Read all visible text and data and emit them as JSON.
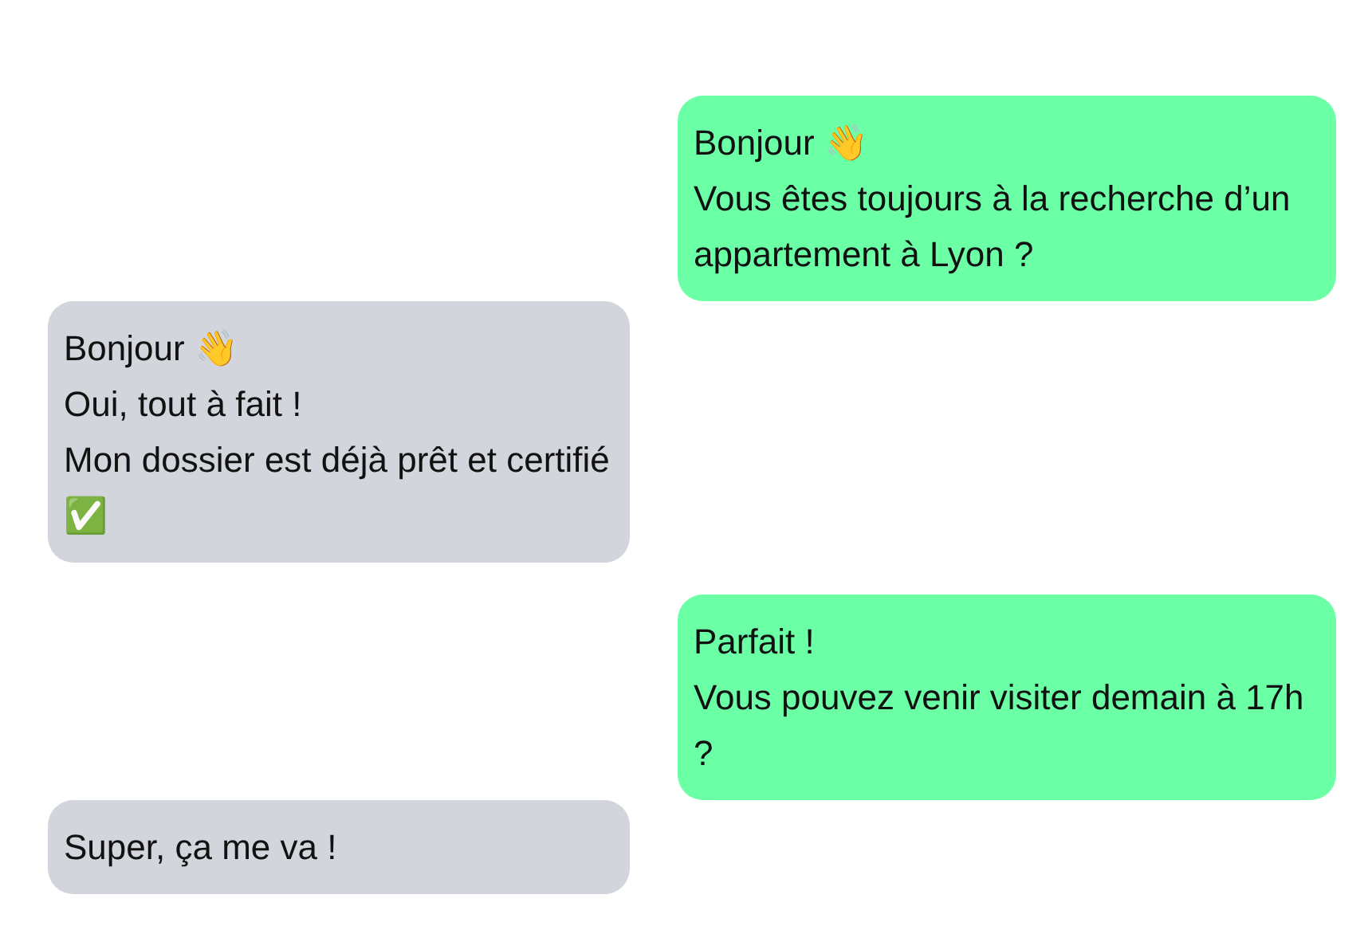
{
  "messages": [
    {
      "kind": "sent",
      "lines": [
        "Bonjour 👋",
        "Vous êtes toujours à la recherche d’un appartement à Lyon ?"
      ]
    },
    {
      "kind": "received",
      "lines": [
        "Bonjour 👋",
        "Oui, tout à fait !",
        "Mon dossier est déjà prêt et certifié ✅"
      ]
    },
    {
      "kind": "sent",
      "lines": [
        "Parfait !",
        "Vous pouvez venir visiter demain à 17h ?"
      ]
    },
    {
      "kind": "received",
      "lines": [
        "Super, ça me va !"
      ]
    }
  ]
}
